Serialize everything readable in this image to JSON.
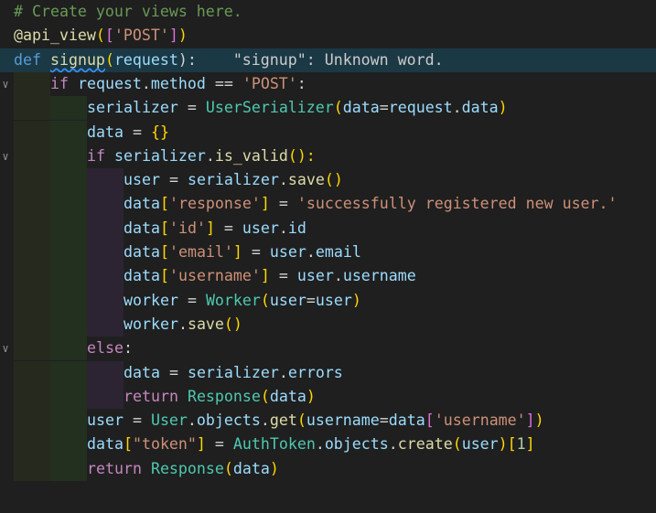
{
  "editor": {
    "lines": [
      {
        "indent": 0,
        "tokens": [
          {
            "t": "# Create your views here.",
            "c": "comment"
          }
        ]
      },
      {
        "indent": 0,
        "tokens": [
          {
            "t": "@api_view",
            "c": "fn"
          },
          {
            "t": "(",
            "c": "br1"
          },
          {
            "t": "[",
            "c": "br2"
          },
          {
            "t": "'POST'",
            "c": "str"
          },
          {
            "t": "]",
            "c": "br2"
          },
          {
            "t": ")",
            "c": "br1"
          }
        ]
      },
      {
        "indent": 0,
        "current": true,
        "fold": true,
        "tokens": [
          {
            "t": "def",
            "c": "kw"
          },
          {
            "t": " ",
            "c": "op"
          },
          {
            "t": "signup",
            "c": "fn",
            "sq": true
          },
          {
            "t": "(",
            "c": "br1"
          },
          {
            "t": "request",
            "c": "var"
          },
          {
            "t": "):",
            "c": "op"
          },
          {
            "t": "    \"signup\": Unknown word.",
            "c": "hint"
          }
        ]
      },
      {
        "indent": 1,
        "fold": true,
        "tokens": [
          {
            "t": "if",
            "c": "ctrl"
          },
          {
            "t": " ",
            "c": "op"
          },
          {
            "t": "request",
            "c": "var"
          },
          {
            "t": ".",
            "c": "op"
          },
          {
            "t": "method",
            "c": "var"
          },
          {
            "t": " == ",
            "c": "op"
          },
          {
            "t": "'POST'",
            "c": "str"
          },
          {
            "t": ":",
            "c": "op"
          }
        ]
      },
      {
        "indent": 2,
        "tokens": [
          {
            "t": "serializer",
            "c": "var"
          },
          {
            "t": " = ",
            "c": "op"
          },
          {
            "t": "UserSerializer",
            "c": "cls"
          },
          {
            "t": "(",
            "c": "br1"
          },
          {
            "t": "data",
            "c": "var"
          },
          {
            "t": "=",
            "c": "op"
          },
          {
            "t": "request",
            "c": "var"
          },
          {
            "t": ".",
            "c": "op"
          },
          {
            "t": "data",
            "c": "var"
          },
          {
            "t": ")",
            "c": "br1"
          }
        ]
      },
      {
        "indent": 2,
        "tokens": [
          {
            "t": "data",
            "c": "var"
          },
          {
            "t": " = ",
            "c": "op"
          },
          {
            "t": "{}",
            "c": "br1"
          }
        ]
      },
      {
        "indent": 2,
        "fold": true,
        "tokens": [
          {
            "t": "if",
            "c": "ctrl"
          },
          {
            "t": " ",
            "c": "op"
          },
          {
            "t": "serializer",
            "c": "var"
          },
          {
            "t": ".",
            "c": "op"
          },
          {
            "t": "is_valid",
            "c": "fn"
          },
          {
            "t": "():",
            "c": "br1"
          }
        ]
      },
      {
        "indent": 3,
        "tokens": [
          {
            "t": "user",
            "c": "var"
          },
          {
            "t": " = ",
            "c": "op"
          },
          {
            "t": "serializer",
            "c": "var"
          },
          {
            "t": ".",
            "c": "op"
          },
          {
            "t": "save",
            "c": "fn"
          },
          {
            "t": "()",
            "c": "br1"
          }
        ]
      },
      {
        "indent": 3,
        "tokens": [
          {
            "t": "data",
            "c": "var"
          },
          {
            "t": "[",
            "c": "br1"
          },
          {
            "t": "'response'",
            "c": "str"
          },
          {
            "t": "]",
            "c": "br1"
          },
          {
            "t": " = ",
            "c": "op"
          },
          {
            "t": "'successfully registered new user.'",
            "c": "str"
          }
        ]
      },
      {
        "indent": 3,
        "tokens": [
          {
            "t": "data",
            "c": "var"
          },
          {
            "t": "[",
            "c": "br1"
          },
          {
            "t": "'id'",
            "c": "str"
          },
          {
            "t": "]",
            "c": "br1"
          },
          {
            "t": " = ",
            "c": "op"
          },
          {
            "t": "user",
            "c": "var"
          },
          {
            "t": ".",
            "c": "op"
          },
          {
            "t": "id",
            "c": "var"
          }
        ]
      },
      {
        "indent": 3,
        "tokens": [
          {
            "t": "data",
            "c": "var"
          },
          {
            "t": "[",
            "c": "br1"
          },
          {
            "t": "'email'",
            "c": "str"
          },
          {
            "t": "]",
            "c": "br1"
          },
          {
            "t": " = ",
            "c": "op"
          },
          {
            "t": "user",
            "c": "var"
          },
          {
            "t": ".",
            "c": "op"
          },
          {
            "t": "email",
            "c": "var"
          }
        ]
      },
      {
        "indent": 3,
        "tokens": [
          {
            "t": "data",
            "c": "var"
          },
          {
            "t": "[",
            "c": "br1"
          },
          {
            "t": "'username'",
            "c": "str"
          },
          {
            "t": "]",
            "c": "br1"
          },
          {
            "t": " = ",
            "c": "op"
          },
          {
            "t": "user",
            "c": "var"
          },
          {
            "t": ".",
            "c": "op"
          },
          {
            "t": "username",
            "c": "var"
          }
        ]
      },
      {
        "indent": 3,
        "tokens": [
          {
            "t": "worker",
            "c": "var"
          },
          {
            "t": " = ",
            "c": "op"
          },
          {
            "t": "Worker",
            "c": "cls"
          },
          {
            "t": "(",
            "c": "br1"
          },
          {
            "t": "user",
            "c": "var"
          },
          {
            "t": "=",
            "c": "op"
          },
          {
            "t": "user",
            "c": "var"
          },
          {
            "t": ")",
            "c": "br1"
          }
        ]
      },
      {
        "indent": 3,
        "tokens": [
          {
            "t": "worker",
            "c": "var"
          },
          {
            "t": ".",
            "c": "op"
          },
          {
            "t": "save",
            "c": "fn"
          },
          {
            "t": "()",
            "c": "br1"
          }
        ]
      },
      {
        "indent": 2,
        "fold": true,
        "tokens": [
          {
            "t": "else",
            "c": "ctrl"
          },
          {
            "t": ":",
            "c": "op"
          }
        ]
      },
      {
        "indent": 3,
        "tokens": [
          {
            "t": "data",
            "c": "var"
          },
          {
            "t": " = ",
            "c": "op"
          },
          {
            "t": "serializer",
            "c": "var"
          },
          {
            "t": ".",
            "c": "op"
          },
          {
            "t": "errors",
            "c": "var"
          }
        ]
      },
      {
        "indent": 3,
        "tokens": [
          {
            "t": "return",
            "c": "ctrl"
          },
          {
            "t": " ",
            "c": "op"
          },
          {
            "t": "Response",
            "c": "cls"
          },
          {
            "t": "(",
            "c": "br1"
          },
          {
            "t": "data",
            "c": "var"
          },
          {
            "t": ")",
            "c": "br1"
          }
        ]
      },
      {
        "indent": 2,
        "tokens": [
          {
            "t": "user",
            "c": "var"
          },
          {
            "t": " = ",
            "c": "op"
          },
          {
            "t": "User",
            "c": "cls"
          },
          {
            "t": ".",
            "c": "op"
          },
          {
            "t": "objects",
            "c": "var"
          },
          {
            "t": ".",
            "c": "op"
          },
          {
            "t": "get",
            "c": "fn"
          },
          {
            "t": "(",
            "c": "br1"
          },
          {
            "t": "username",
            "c": "var"
          },
          {
            "t": "=",
            "c": "op"
          },
          {
            "t": "data",
            "c": "var"
          },
          {
            "t": "[",
            "c": "br2"
          },
          {
            "t": "'username'",
            "c": "str"
          },
          {
            "t": "]",
            "c": "br2"
          },
          {
            "t": ")",
            "c": "br1"
          }
        ]
      },
      {
        "indent": 2,
        "tokens": [
          {
            "t": "data",
            "c": "var"
          },
          {
            "t": "[",
            "c": "br1"
          },
          {
            "t": "\"token\"",
            "c": "str"
          },
          {
            "t": "]",
            "c": "br1"
          },
          {
            "t": " = ",
            "c": "op"
          },
          {
            "t": "AuthToken",
            "c": "cls"
          },
          {
            "t": ".",
            "c": "op"
          },
          {
            "t": "objects",
            "c": "var"
          },
          {
            "t": ".",
            "c": "op"
          },
          {
            "t": "create",
            "c": "fn"
          },
          {
            "t": "(",
            "c": "br1"
          },
          {
            "t": "user",
            "c": "var"
          },
          {
            "t": ")",
            "c": "br1"
          },
          {
            "t": "[",
            "c": "br1"
          },
          {
            "t": "1",
            "c": "num"
          },
          {
            "t": "]",
            "c": "br1"
          }
        ]
      },
      {
        "indent": 2,
        "tokens": [
          {
            "t": "return",
            "c": "ctrl"
          },
          {
            "t": " ",
            "c": "op"
          },
          {
            "t": "Response",
            "c": "cls"
          },
          {
            "t": "(",
            "c": "br1"
          },
          {
            "t": "data",
            "c": "var"
          },
          {
            "t": ")",
            "c": "br1"
          }
        ]
      }
    ]
  }
}
